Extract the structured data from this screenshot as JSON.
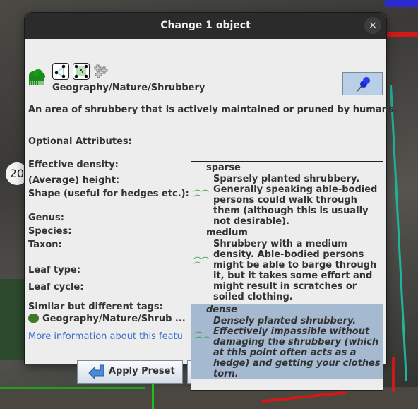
{
  "dialog": {
    "title": "Change 1 object",
    "close_label": "×",
    "preset_path": "Geography/Nature/Shrubbery",
    "description": "An area of shrubbery that is actively maintained or pruned by humans.",
    "section_optional": "Optional Attributes:",
    "fields": {
      "effective_density": "Effective density:",
      "average_height": "(Average) height:",
      "shape": "Shape (useful for hedges etc.):",
      "genus": "Genus:",
      "species": "Species:",
      "taxon": "Taxon:",
      "leaf_type": "Leaf type:",
      "leaf_cycle": "Leaf cycle:"
    },
    "density_value": "dense",
    "similar_label": "Similar but different tags:",
    "similar_item": "Geography/Nature/Shrub ...",
    "more_info_link": "More information about this featu",
    "apply_label": "Apply Preset"
  },
  "density_options": [
    {
      "name": "sparse",
      "desc": "Sparsely planted shrubbery.\nGenerally speaking able-bodied\npersons could walk through\nthem (although this is usually\nnot desirable).",
      "selected": false
    },
    {
      "name": "medium",
      "desc": "Shrubbery with a medium\ndensity. Able-bodied persons\nmight be able to barge through\nit, but it takes some effort and\nmight result in scratches or\nsoiled clothing.",
      "selected": false
    },
    {
      "name": "dense",
      "desc": "Densely planted shrubbery.\nEffectively impassible without\ndamaging the shrubbery (which\nat this point often acts as a\nhedge) and getting your clothes\ntorn.",
      "selected": true
    }
  ],
  "map": {
    "zoom_badge": "20"
  },
  "colors": {
    "selection": "#a5b9d0",
    "pin_bg": "#b8cfe6",
    "link": "#3a6ec9"
  }
}
